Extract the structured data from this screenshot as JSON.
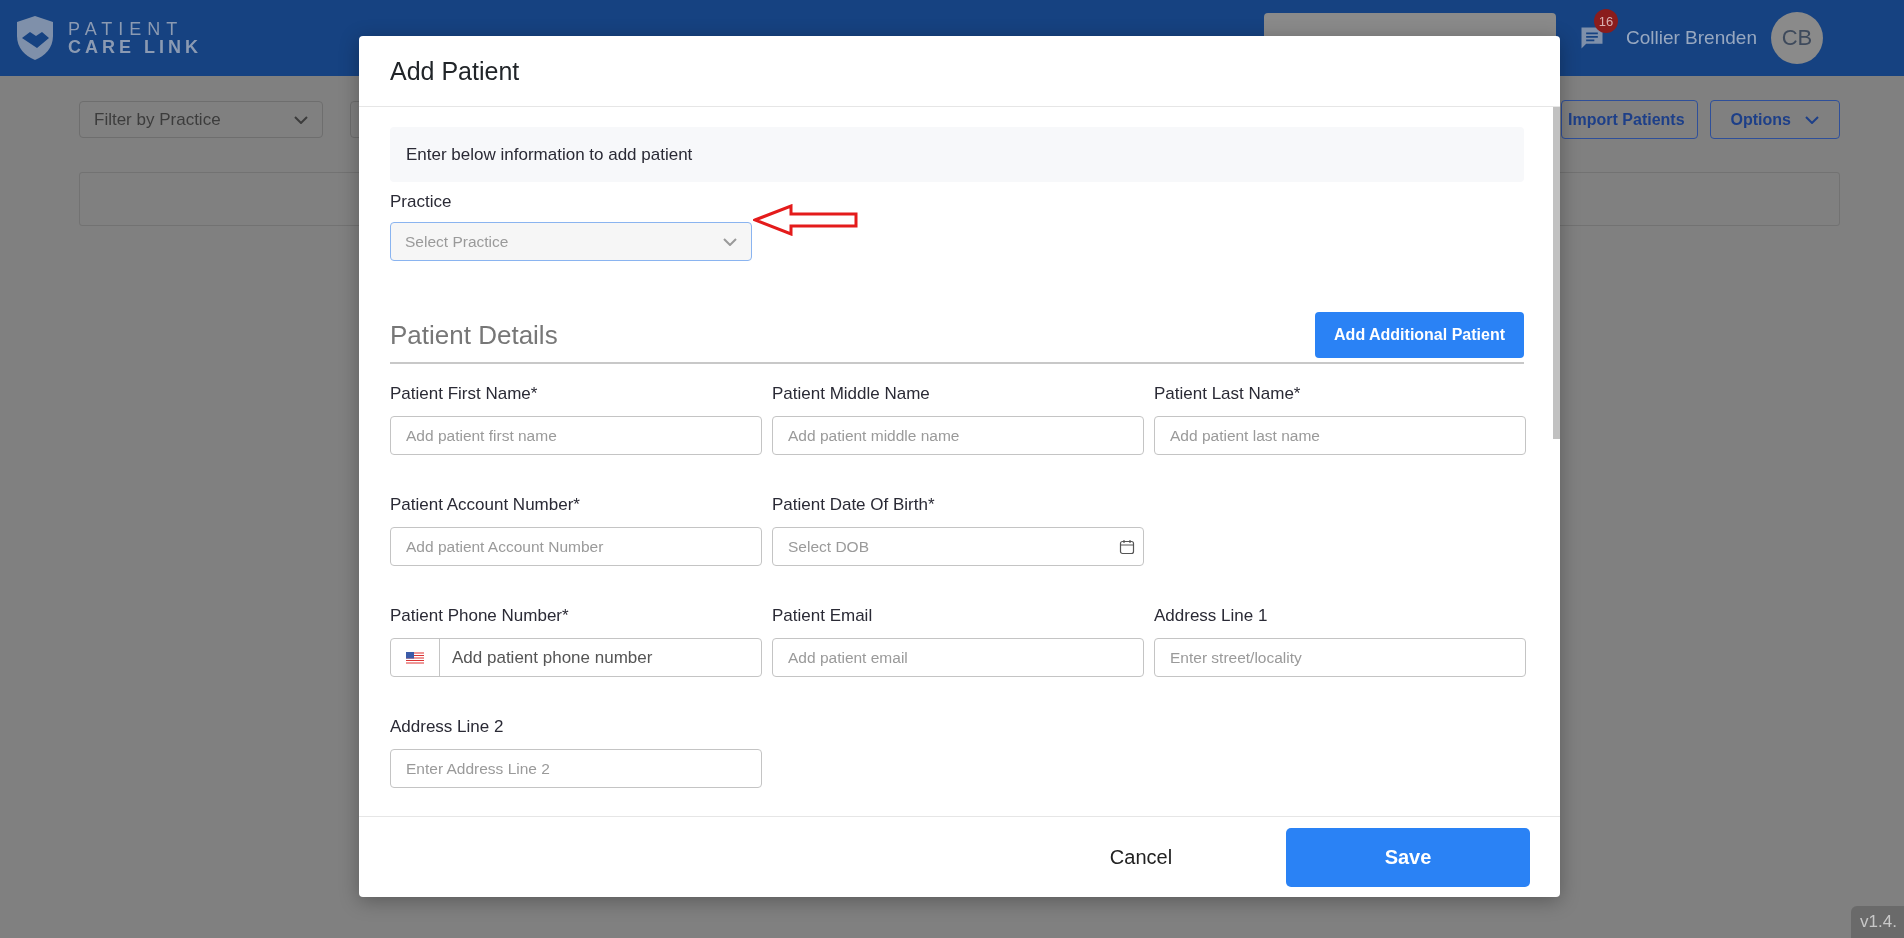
{
  "header": {
    "logo": {
      "line_1": "PATIENT",
      "line_2": "CARE LINK"
    },
    "messages": {
      "badge": "16"
    },
    "user": {
      "name": "Collier Brenden",
      "initials": "CB"
    }
  },
  "toolbar": {
    "filter": {
      "placeholder": "Filter by Practice"
    },
    "buttons": [
      {
        "label": "Import Patients",
        "kind": "plain"
      },
      {
        "label": "Options",
        "kind": "dropdown"
      }
    ]
  },
  "dialog": {
    "title": "Add Patient",
    "intro": "Enter below information to add patient",
    "practice": {
      "label": "Practice",
      "placeholder": "Select Practice"
    },
    "section_title": "Patient Details",
    "add_button": "Add Additional Patient",
    "rows": [
      [
        {
          "label": "Patient First Name*",
          "placeholder": "Add patient first name",
          "kind": "text"
        },
        {
          "label": "Patient Middle Name",
          "placeholder": "Add patient middle name",
          "kind": "text"
        },
        {
          "label": "Patient Last Name*",
          "placeholder": "Add patient last name",
          "kind": "text"
        }
      ],
      [
        {
          "label": "Patient Account Number*",
          "placeholder": "Add patient Account Number",
          "kind": "text"
        },
        {
          "label": "Patient Date Of Birth*",
          "placeholder": "Select DOB",
          "kind": "date"
        }
      ],
      [
        {
          "label": "Patient Phone Number*",
          "placeholder": "Add patient phone number",
          "kind": "phone"
        },
        {
          "label": "Patient Email",
          "placeholder": "Add patient email",
          "kind": "text"
        },
        {
          "label": "Address Line 1",
          "placeholder": "Enter street/locality",
          "kind": "text"
        }
      ],
      [
        {
          "label": "Address Line 2",
          "placeholder": "Enter Address Line 2",
          "kind": "text"
        }
      ]
    ],
    "buttons": [
      {
        "label": "Cancel",
        "kind": "secondary"
      },
      {
        "label": "Save",
        "kind": "primary"
      }
    ]
  },
  "version": "v1.4."
}
